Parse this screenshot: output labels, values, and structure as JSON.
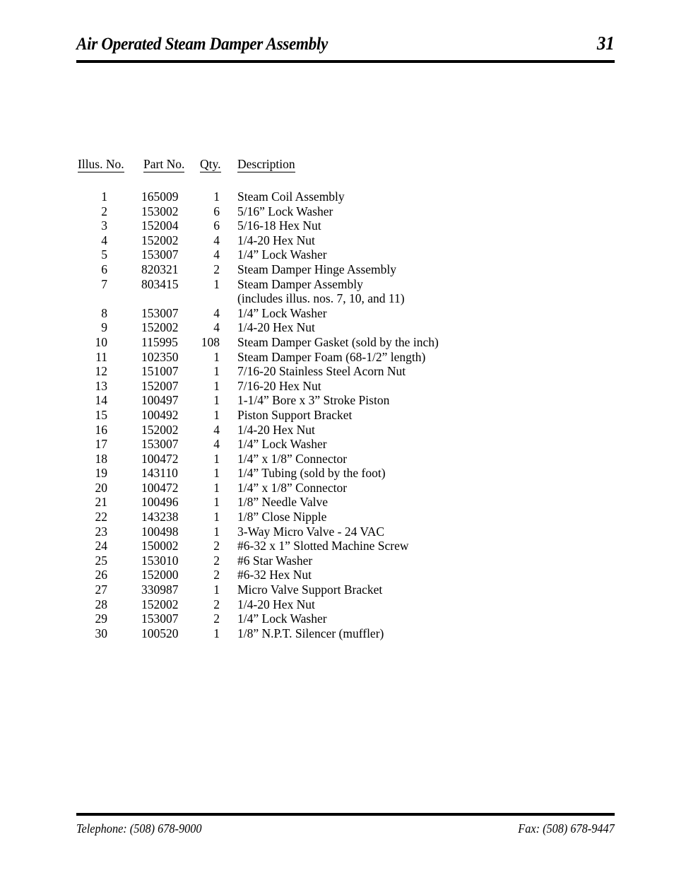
{
  "header": {
    "title": "Air Operated Steam Damper Assembly",
    "page_number": "31"
  },
  "table": {
    "columns": {
      "illus": "Illus. No.",
      "part": "Part  No.",
      "qty": "Qty.",
      "description": "Description"
    },
    "rows": [
      {
        "illus": "1",
        "part": "165009",
        "qty": "1",
        "description": "Steam Coil Assembly"
      },
      {
        "illus": "2",
        "part": "153002",
        "qty": "6",
        "description": "5/16” Lock Washer"
      },
      {
        "illus": "3",
        "part": "152004",
        "qty": "6",
        "description": "5/16-18 Hex Nut"
      },
      {
        "illus": "4",
        "part": "152002",
        "qty": "4",
        "description": "1/4-20 Hex Nut"
      },
      {
        "illus": "5",
        "part": "153007",
        "qty": "4",
        "description": "1/4” Lock Washer"
      },
      {
        "illus": "6",
        "part": "820321",
        "qty": "2",
        "description": "Steam Damper Hinge Assembly"
      },
      {
        "illus": "7",
        "part": "803415",
        "qty": "1",
        "description": "Steam Damper Assembly"
      },
      {
        "illus": "",
        "part": "",
        "qty": "",
        "description": "(includes illus. nos. 7, 10, and 11)",
        "continuation": true
      },
      {
        "illus": "8",
        "part": "153007",
        "qty": "4",
        "description": "1/4” Lock Washer"
      },
      {
        "illus": "9",
        "part": "152002",
        "qty": "4",
        "description": "1/4-20 Hex Nut"
      },
      {
        "illus": "10",
        "part": "115995",
        "qty": "108",
        "description": "Steam Damper Gasket (sold by the inch)"
      },
      {
        "illus": "11",
        "part": "102350",
        "qty": "1",
        "description": "Steam Damper Foam (68-1/2” length)"
      },
      {
        "illus": "12",
        "part": "151007",
        "qty": "1",
        "description": "7/16-20 Stainless Steel Acorn Nut"
      },
      {
        "illus": "13",
        "part": "152007",
        "qty": "1",
        "description": "7/16-20 Hex Nut"
      },
      {
        "illus": "14",
        "part": "100497",
        "qty": "1",
        "description": "1-1/4” Bore x 3” Stroke Piston"
      },
      {
        "illus": "15",
        "part": "100492",
        "qty": "1",
        "description": "Piston Support Bracket"
      },
      {
        "illus": "16",
        "part": "152002",
        "qty": "4",
        "description": "1/4-20 Hex Nut"
      },
      {
        "illus": "17",
        "part": "153007",
        "qty": "4",
        "description": "1/4” Lock Washer"
      },
      {
        "illus": "18",
        "part": "100472",
        "qty": "1",
        "description": "1/4” x 1/8” Connector"
      },
      {
        "illus": "19",
        "part": "143110",
        "qty": "1",
        "description": "1/4” Tubing (sold by the foot)"
      },
      {
        "illus": "20",
        "part": "100472",
        "qty": "1",
        "description": "1/4” x 1/8” Connector"
      },
      {
        "illus": "21",
        "part": "100496",
        "qty": "1",
        "description": "1/8” Needle Valve"
      },
      {
        "illus": "22",
        "part": "143238",
        "qty": "1",
        "description": "1/8” Close Nipple"
      },
      {
        "illus": "23",
        "part": "100498",
        "qty": "1",
        "description": "3-Way Micro Valve - 24 VAC"
      },
      {
        "illus": "24",
        "part": "150002",
        "qty": "2",
        "description": "#6-32 x 1” Slotted Machine Screw"
      },
      {
        "illus": "25",
        "part": "153010",
        "qty": "2",
        "description": "#6  Star  Washer"
      },
      {
        "illus": "26",
        "part": "152000",
        "qty": "2",
        "description": "#6-32 Hex Nut"
      },
      {
        "illus": "27",
        "part": "330987",
        "qty": "1",
        "description": "Micro Valve Support Bracket"
      },
      {
        "illus": "28",
        "part": "152002",
        "qty": "2",
        "description": "1/4-20 Hex Nut"
      },
      {
        "illus": "29",
        "part": "153007",
        "qty": "2",
        "description": "1/4” Lock Washer"
      },
      {
        "illus": "30",
        "part": "100520",
        "qty": "1",
        "description": "1/8” N.P.T. Silencer (muffler)"
      }
    ]
  },
  "footer": {
    "telephone": "Telephone: (508) 678-9000",
    "fax": "Fax: (508) 678-9447"
  }
}
